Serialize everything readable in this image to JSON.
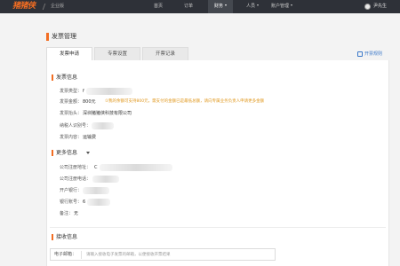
{
  "nav": {
    "logo": "猪猪侠",
    "edition": "企业版",
    "items": [
      "首页",
      "订单",
      "财务",
      "人员",
      "账户管理"
    ],
    "user_name": "尹先生"
  },
  "page": {
    "title": "发票管理",
    "tabs": [
      "发票申请",
      "专票设置",
      "开票记录"
    ],
    "settings_link": "开票规则"
  },
  "invoice_info": {
    "title": "发票信息",
    "type_label": "发票类型：",
    "type_value": "f",
    "amount_label": "发票金额：",
    "amount_value": "800元",
    "amount_notice": "①我的余额可支持800元，需支付的金额已是最低总额，请向专属业务负责人申请更多金额",
    "header_label": "发票抬头：",
    "header_value": "深圳猪猪侠科技有限公司",
    "tax_id_label": "纳税人识别号：",
    "content_label": "发票内容：",
    "content_value": "运输费"
  },
  "more_info": {
    "title": "更多信息",
    "company_address_label": "公司注册地址：",
    "company_address_value": "C",
    "company_phone_label": "公司注册电话：",
    "bank_label": "开户银行：",
    "account_label": "银行账号：",
    "account_value": "6",
    "remark_label": "备注：",
    "remark_value": "无"
  },
  "receive_info": {
    "title": "接收信息",
    "email_label": "电子邮箱：",
    "email_placeholder": "请输入接收电子发票的邮箱，以便接收开票结果"
  },
  "colors": {
    "accent": "#f26d22",
    "nav_bg": "#2e3138",
    "link": "#3a78c9",
    "warning": "#e0981f"
  }
}
